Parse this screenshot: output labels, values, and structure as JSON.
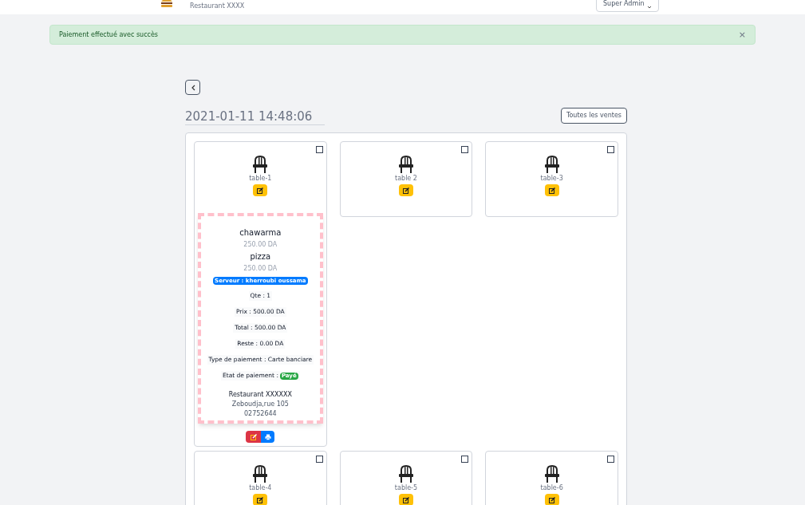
{
  "header": {
    "restaurant": "Restaurant XXXX",
    "user_menu": "Super Admin"
  },
  "alert": {
    "message": "Paiement effectué avec succès",
    "close": "×"
  },
  "date": "2021-01-11 14:48:06",
  "all_sales_button": "Toutes les ventes",
  "tables": [
    {
      "label": "table-1",
      "checked": false,
      "receipt": {
        "items": [
          {
            "name": "chawarma",
            "price": "250.00 DA"
          },
          {
            "name": "pizza",
            "price": "250.00 DA"
          }
        ],
        "server": "Serveur : kherroubi oussama",
        "lines": [
          "Qte : 1",
          "Prix : 500.00 DA",
          "Total : 500.00 DA",
          "Reste : 0.00 DA",
          "Type de paiement : Carte banciare"
        ],
        "status_label": "Etat de paiement :",
        "status": "Payé",
        "paid": true,
        "restaurant": "Restaurant XXXXXX",
        "address": "Zeboudja,rue 105",
        "phone": "02752644"
      }
    },
    {
      "label": "table 2",
      "checked": false
    },
    {
      "label": "table-3",
      "checked": false
    },
    {
      "label": "table-4",
      "checked": false
    },
    {
      "label": "table-5",
      "checked": false
    },
    {
      "label": "table-6",
      "checked": false
    }
  ]
}
